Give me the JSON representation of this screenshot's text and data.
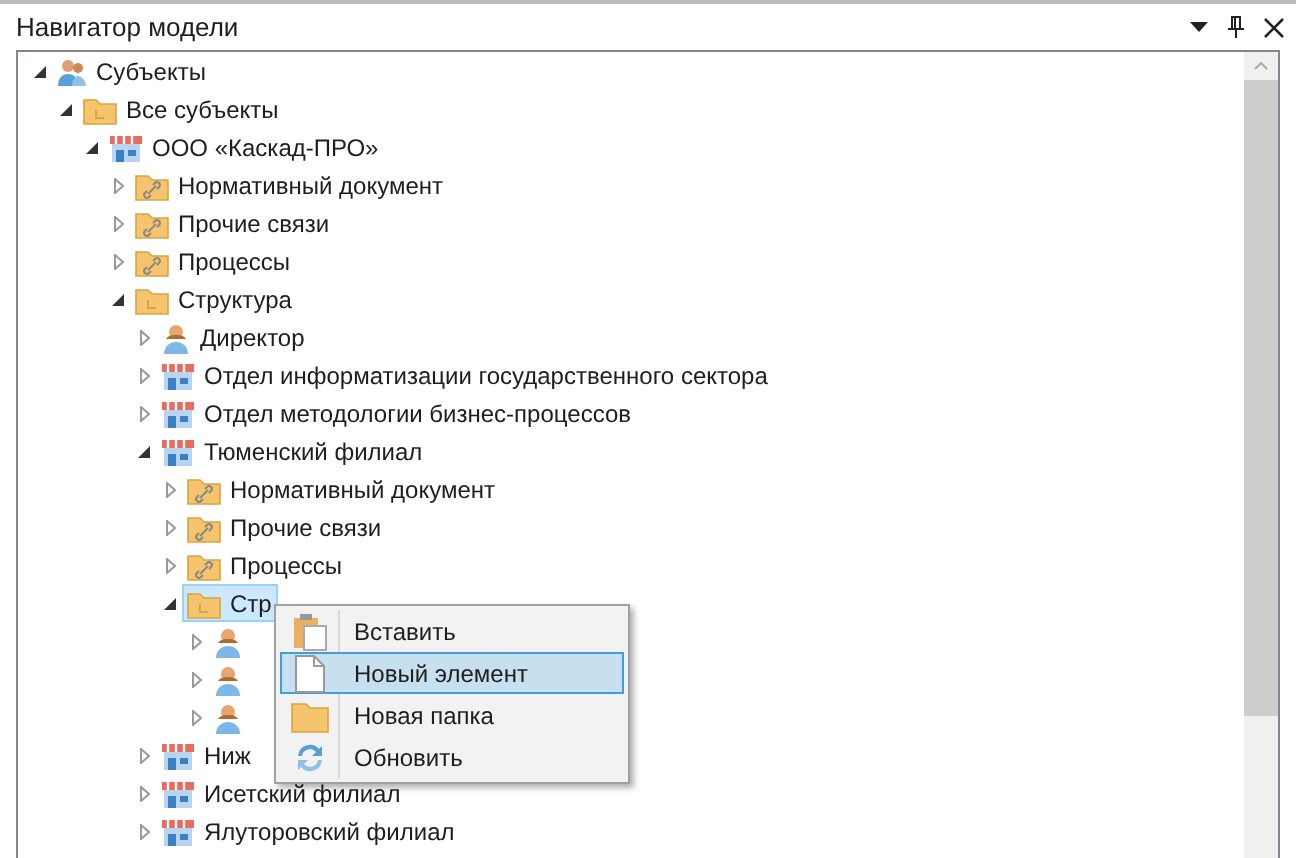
{
  "panel": {
    "title": "Навигатор модели"
  },
  "tree": [
    {
      "label": "Субъекты",
      "kind": "people",
      "expanded": true,
      "selected": false,
      "children": [
        {
          "label": "Все субъекты",
          "kind": "folder",
          "expanded": true,
          "selected": false,
          "children": [
            {
              "label": "ООО «Каскад-ПРО»",
              "kind": "org",
              "expanded": true,
              "selected": false,
              "children": [
                {
                  "label": "Нормативный документ",
                  "kind": "link-folder",
                  "expanded": false,
                  "selected": false
                },
                {
                  "label": "Прочие связи",
                  "kind": "link-folder",
                  "expanded": false,
                  "selected": false
                },
                {
                  "label": "Процессы",
                  "kind": "link-folder",
                  "expanded": false,
                  "selected": false
                },
                {
                  "label": "Структура",
                  "kind": "folder",
                  "expanded": true,
                  "selected": false,
                  "children": [
                    {
                      "label": "Директор",
                      "kind": "person",
                      "expanded": false,
                      "selected": false
                    },
                    {
                      "label": "Отдел информатизации государственного сектора",
                      "kind": "org",
                      "expanded": false,
                      "selected": false
                    },
                    {
                      "label": "Отдел методологии бизнес-процессов",
                      "kind": "org",
                      "expanded": false,
                      "selected": false
                    },
                    {
                      "label": "Тюменский филиал",
                      "kind": "org",
                      "expanded": true,
                      "selected": false,
                      "children": [
                        {
                          "label": "Нормативный документ",
                          "kind": "link-folder",
                          "expanded": false,
                          "selected": false
                        },
                        {
                          "label": "Прочие связи",
                          "kind": "link-folder",
                          "expanded": false,
                          "selected": false
                        },
                        {
                          "label": "Процессы",
                          "kind": "link-folder",
                          "expanded": false,
                          "selected": false
                        },
                        {
                          "label": "Стр",
                          "kind": "folder",
                          "expanded": true,
                          "selected": true,
                          "children": [
                            {
                              "kind": "person",
                              "expanded": false,
                              "selected": false
                            },
                            {
                              "kind": "person",
                              "expanded": false,
                              "selected": false
                            },
                            {
                              "kind": "person",
                              "expanded": false,
                              "selected": false
                            }
                          ]
                        }
                      ]
                    },
                    {
                      "label": "Ниж",
                      "kind": "org",
                      "expanded": false,
                      "selected": false
                    },
                    {
                      "label": "Исетский филиал",
                      "kind": "org",
                      "expanded": false,
                      "selected": false
                    },
                    {
                      "label": "Ялуторовский филиал",
                      "kind": "org",
                      "expanded": false,
                      "selected": false
                    }
                  ]
                }
              ]
            }
          ]
        }
      ]
    }
  ],
  "context_menu": [
    {
      "label": "Вставить",
      "kind": "paste",
      "selected": false
    },
    {
      "label": "Новый элемент",
      "kind": "document",
      "selected": true
    },
    {
      "label": "Новая папка",
      "kind": "folder",
      "selected": false
    },
    {
      "label": "Обновить",
      "kind": "refresh",
      "selected": false
    }
  ]
}
